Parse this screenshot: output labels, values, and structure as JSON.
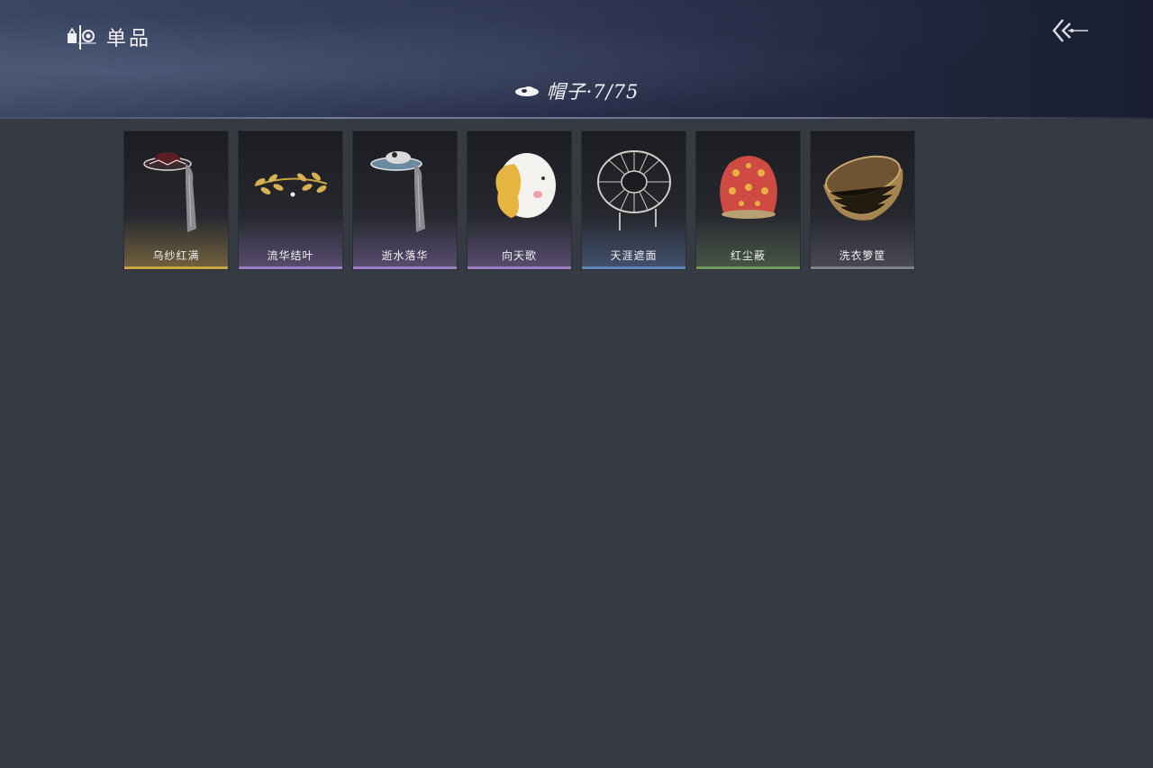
{
  "header": {
    "app_title": "单品",
    "app_icon": "wardrobe-icon",
    "back_icon": "double-chevron-back-icon",
    "category_icon": "hat-icon",
    "category_title": "帽子·7/75"
  },
  "items": [
    {
      "name": "乌纱红满",
      "icon": "veiled-hat-red-icon",
      "rarity_color": "#c9a544"
    },
    {
      "name": "流华结叶",
      "icon": "golden-laurel-wreath-icon",
      "rarity_color": "#9a7fc4"
    },
    {
      "name": "逝水落华",
      "icon": "veiled-hat-silver-icon",
      "rarity_color": "#9a7fc4"
    },
    {
      "name": "向天歌",
      "icon": "goose-hat-icon",
      "rarity_color": "#9a7fc4"
    },
    {
      "name": "天涯遮面",
      "icon": "bamboo-frame-hat-icon",
      "rarity_color": "#5f86b8"
    },
    {
      "name": "红尘蔽",
      "icon": "red-cloth-hood-icon",
      "rarity_color": "#6f9a5a"
    },
    {
      "name": "洗衣箩筐",
      "icon": "wicker-basket-icon",
      "rarity_color": "#7d8290"
    }
  ]
}
